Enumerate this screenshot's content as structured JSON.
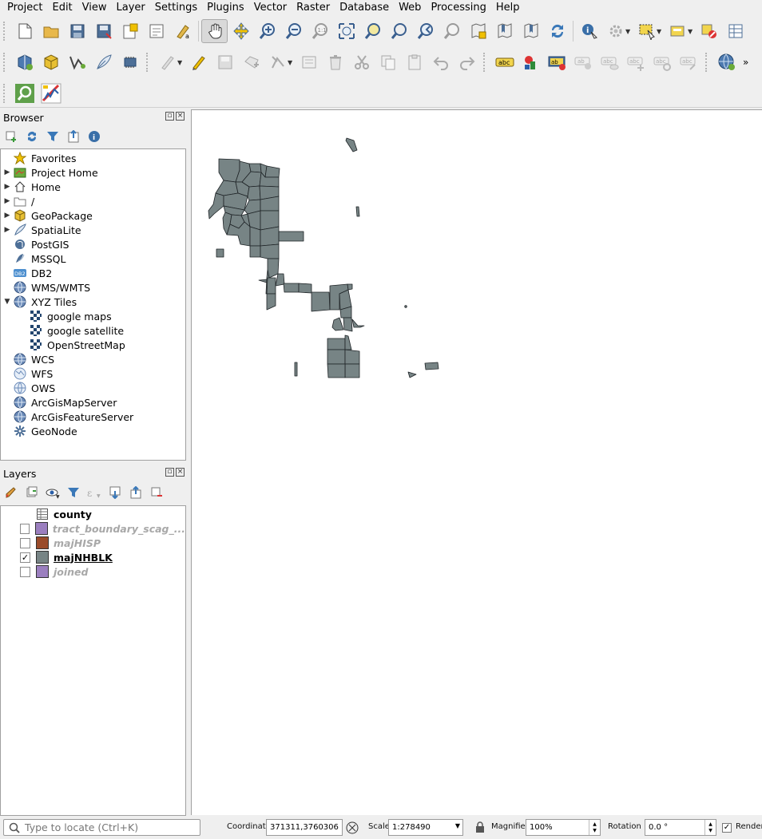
{
  "menu": [
    "Project",
    "Edit",
    "View",
    "Layer",
    "Settings",
    "Plugins",
    "Vector",
    "Raster",
    "Database",
    "Web",
    "Processing",
    "Help"
  ],
  "browser": {
    "title": "Browser",
    "items": [
      {
        "label": "Favorites",
        "icon": "star-icon",
        "expand": ""
      },
      {
        "label": "Project Home",
        "icon": "project-home-icon",
        "expand": "▶"
      },
      {
        "label": "Home",
        "icon": "home-icon",
        "expand": "▶"
      },
      {
        "label": "/",
        "icon": "folder-icon",
        "expand": "▶"
      },
      {
        "label": "GeoPackage",
        "icon": "geopackage-icon",
        "expand": "▶"
      },
      {
        "label": "SpatiaLite",
        "icon": "spatialite-icon",
        "expand": "▶"
      },
      {
        "label": "PostGIS",
        "icon": "postgis-icon",
        "expand": ""
      },
      {
        "label": "MSSQL",
        "icon": "mssql-icon",
        "expand": ""
      },
      {
        "label": "DB2",
        "icon": "db2-icon",
        "expand": ""
      },
      {
        "label": "WMS/WMTS",
        "icon": "wms-icon",
        "expand": ""
      },
      {
        "label": "XYZ Tiles",
        "icon": "xyz-icon",
        "expand": "▼"
      },
      {
        "label": "google maps",
        "icon": "tile-icon",
        "expand": "",
        "child": true
      },
      {
        "label": "google satellite",
        "icon": "tile-icon",
        "expand": "",
        "child": true
      },
      {
        "label": "OpenStreetMap",
        "icon": "tile-icon",
        "expand": "",
        "child": true
      },
      {
        "label": "WCS",
        "icon": "wcs-icon",
        "expand": ""
      },
      {
        "label": "WFS",
        "icon": "wfs-icon",
        "expand": ""
      },
      {
        "label": "OWS",
        "icon": "ows-icon",
        "expand": ""
      },
      {
        "label": "ArcGisMapServer",
        "icon": "arcgis-map-icon",
        "expand": ""
      },
      {
        "label": "ArcGisFeatureServer",
        "icon": "arcgis-feature-icon",
        "expand": ""
      },
      {
        "label": "GeoNode",
        "icon": "geonode-icon",
        "expand": ""
      }
    ]
  },
  "layers": {
    "title": "Layers",
    "items": [
      {
        "label": "county",
        "checkbox": "none",
        "swatch": "table",
        "state": "on"
      },
      {
        "label": "tract_boundary_scag_...",
        "checkbox": "unchecked",
        "swatch": "#9b7fbf",
        "state": "off"
      },
      {
        "label": "majHISP",
        "checkbox": "unchecked",
        "swatch": "#9a4b2a",
        "state": "off"
      },
      {
        "label": "majNHBLK",
        "checkbox": "checked",
        "swatch": "#778485",
        "state": "current"
      },
      {
        "label": "joined",
        "checkbox": "unchecked",
        "swatch": "#9b7fbf",
        "state": "off"
      }
    ]
  },
  "status": {
    "locator_placeholder": "Type to locate (Ctrl+K)",
    "coordinate_label": "Coordinate",
    "coordinate_value": "371311,3760306",
    "scale_label": "Scale",
    "scale_value": "1:278490",
    "magnifier_label": "Magnifier",
    "magnifier_value": "100%",
    "rotation_label": "Rotation",
    "rotation_value": "0.0 °",
    "render_label": "Render"
  },
  "colors": {
    "polygon_fill": "#778485",
    "polygon_stroke": "#1e2326"
  }
}
